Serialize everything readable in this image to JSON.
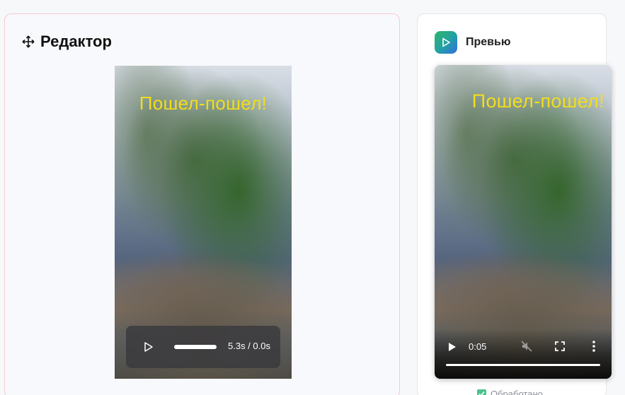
{
  "editor": {
    "title": "Редактор",
    "icon": "move-icon",
    "overlay_text": "Пошел-пошел!",
    "player": {
      "time": "5.3s / 0.0s",
      "progress": 1.0
    }
  },
  "preview": {
    "title": "Превью",
    "icon": "play-logo-icon",
    "overlay_text": "Пошел-пошел!",
    "player": {
      "time": "0:05",
      "progress": 1.0
    },
    "status": "Обработано"
  },
  "colors": {
    "overlay_text": "#f2dd1c",
    "editor_border": "#f4c9d4",
    "status_check": "#4cc38a"
  }
}
